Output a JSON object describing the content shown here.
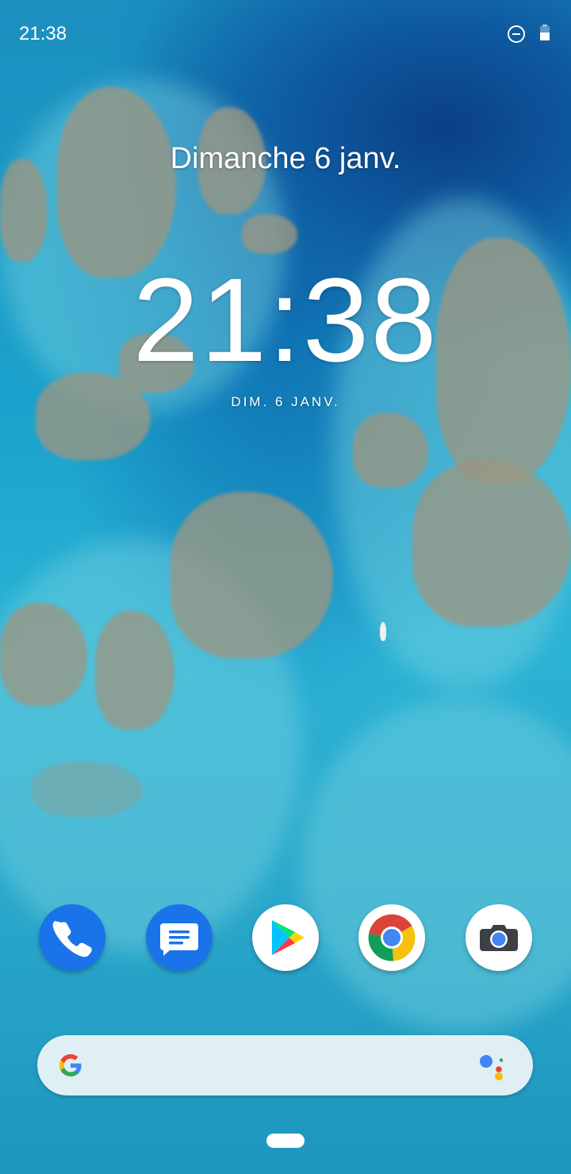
{
  "status_bar": {
    "time": "21:38",
    "icons": [
      "do-not-disturb-icon",
      "battery-icon"
    ]
  },
  "lock_screen": {
    "date_long": "Dimanche 6 janv.",
    "clock": "21:38",
    "date_short": "DIM. 6 JANV."
  },
  "dock": {
    "apps": [
      "phone-icon",
      "messages-icon",
      "play-store-icon",
      "chrome-icon",
      "camera-icon"
    ]
  },
  "search_bar": {
    "icons": [
      "google-g-icon",
      "google-assistant-icon"
    ]
  },
  "colors": {
    "accent_blue": "#1a73e8",
    "google_blue": "#4285f4",
    "google_red": "#ea4335",
    "google_yellow": "#fbbc05",
    "google_green": "#34a853",
    "sea_dark": "#0b3f86",
    "sea_light": "#2bb2d6"
  }
}
